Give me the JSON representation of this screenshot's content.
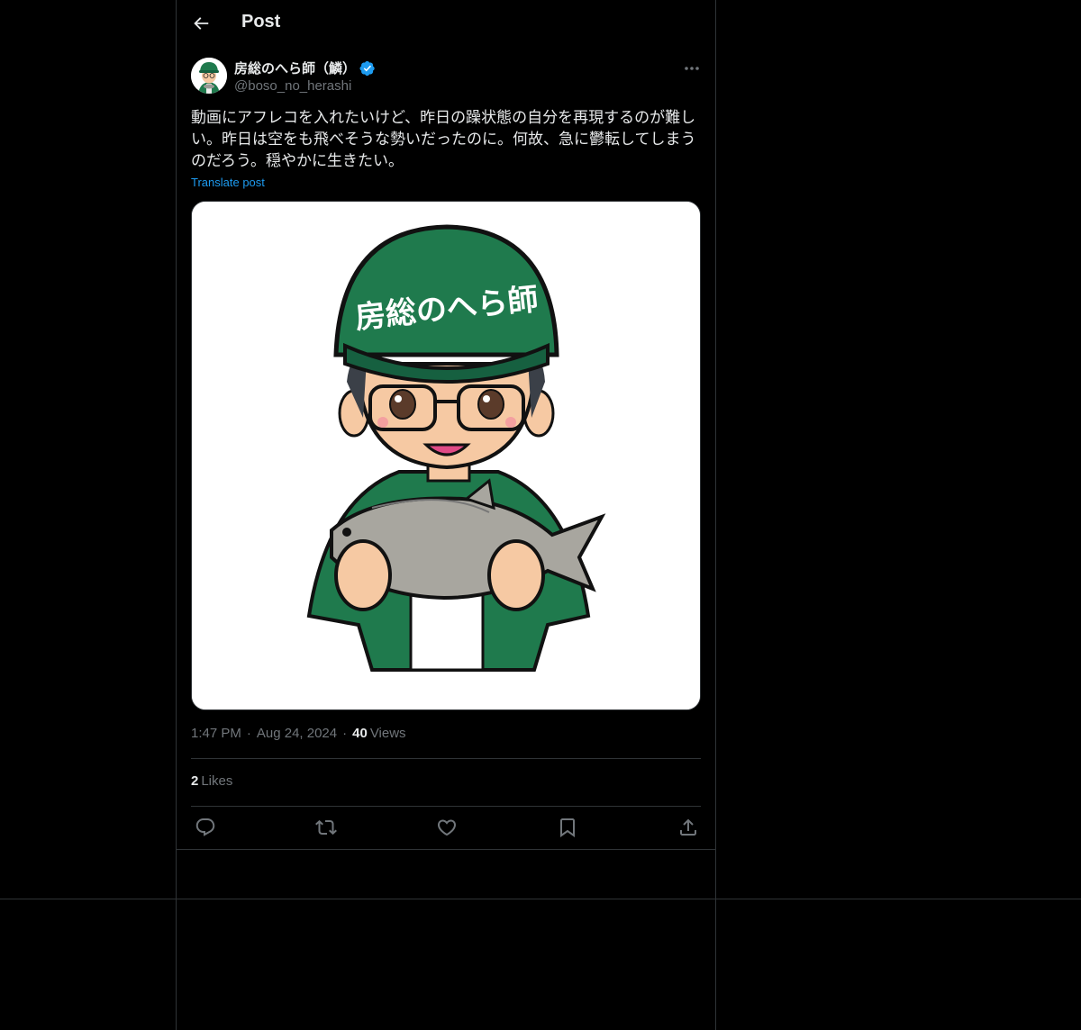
{
  "header": {
    "title": "Post"
  },
  "author": {
    "name": "房総のへら師（鱗）",
    "handle": "@boso_no_herashi",
    "verified": true
  },
  "post": {
    "text": "動画にアフレコを入れたいけど、昨日の躁状態の自分を再現するのが難しい。昨日は空をも飛べそうな勢いだったのに。何故、急に鬱転してしまうのだろう。穏やかに生きたい。",
    "translate_label": "Translate post",
    "media": {
      "cap_text": "房総のへら師"
    },
    "time": "1:47 PM",
    "date": "Aug 24, 2024",
    "views_count": "40",
    "views_label": "Views",
    "likes_count": "2",
    "likes_label": "Likes"
  },
  "icons": [
    "back-arrow-icon",
    "verified-badge-icon",
    "more-icon",
    "reply-icon",
    "repost-icon",
    "like-icon",
    "bookmark-icon",
    "share-icon"
  ],
  "colors": {
    "background": "#000000",
    "text": "#e7e9ea",
    "muted": "#71767b",
    "accent": "#1d9bf0",
    "border": "#2f3336",
    "cap_green": "#1f7a4d"
  }
}
